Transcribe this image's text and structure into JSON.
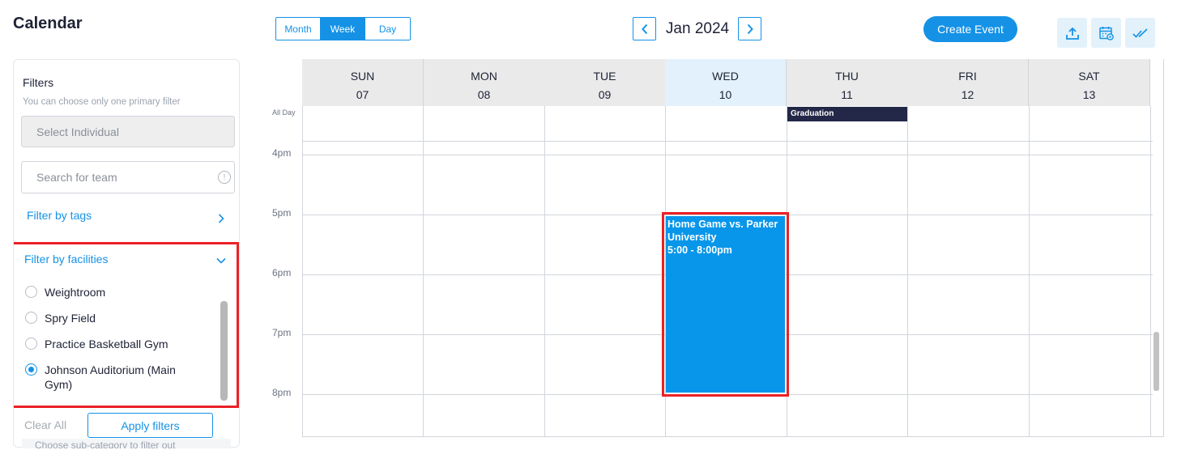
{
  "app": {
    "title": "Calendar"
  },
  "view_toggle": {
    "options": [
      "Month",
      "Week",
      "Day"
    ],
    "active": "Week"
  },
  "date_nav": {
    "label": "Jan 2024",
    "prev_icon": "chevron-left-icon",
    "next_icon": "chevron-right-icon"
  },
  "toolbar": {
    "create_label": "Create Event",
    "icons": [
      "upload-icon",
      "calendar-settings-icon",
      "double-check-icon"
    ]
  },
  "filters": {
    "title": "Filters",
    "hint": "You can choose only one primary filter",
    "individual_placeholder": "Select Individual",
    "search_placeholder": "Search for team",
    "tags_label": "Filter by tags",
    "facilities_label": "Filter by facilities",
    "facilities": [
      {
        "label": "Weightroom",
        "checked": false
      },
      {
        "label": "Spry Field",
        "checked": false
      },
      {
        "label": "Practice Basketball Gym",
        "checked": false
      },
      {
        "label": "Johnson Auditorium (Main Gym)",
        "checked": true
      }
    ],
    "clear_label": "Clear All",
    "apply_label": "Apply filters",
    "subcategory_hint": "Choose sub-category to filter out"
  },
  "calendar": {
    "allday_label": "All Day",
    "days": [
      {
        "name": "SUN",
        "num": "07"
      },
      {
        "name": "MON",
        "num": "08"
      },
      {
        "name": "TUE",
        "num": "09"
      },
      {
        "name": "WED",
        "num": "10",
        "today": true
      },
      {
        "name": "THU",
        "num": "11"
      },
      {
        "name": "FRI",
        "num": "12"
      },
      {
        "name": "SAT",
        "num": "13"
      }
    ],
    "times": [
      "4pm",
      "5pm",
      "6pm",
      "7pm",
      "8pm"
    ],
    "events": {
      "graduation": {
        "title": "Graduation",
        "day": "THU",
        "all_day": true
      },
      "home_game": {
        "title": "Home Game vs. Parker University",
        "time": "5:00 - 8:00pm",
        "day": "WED"
      }
    },
    "colors": {
      "accent": "#1592e6",
      "event_blue": "#0796ea",
      "event_dark": "#232848",
      "highlight": "#ea2126"
    }
  }
}
